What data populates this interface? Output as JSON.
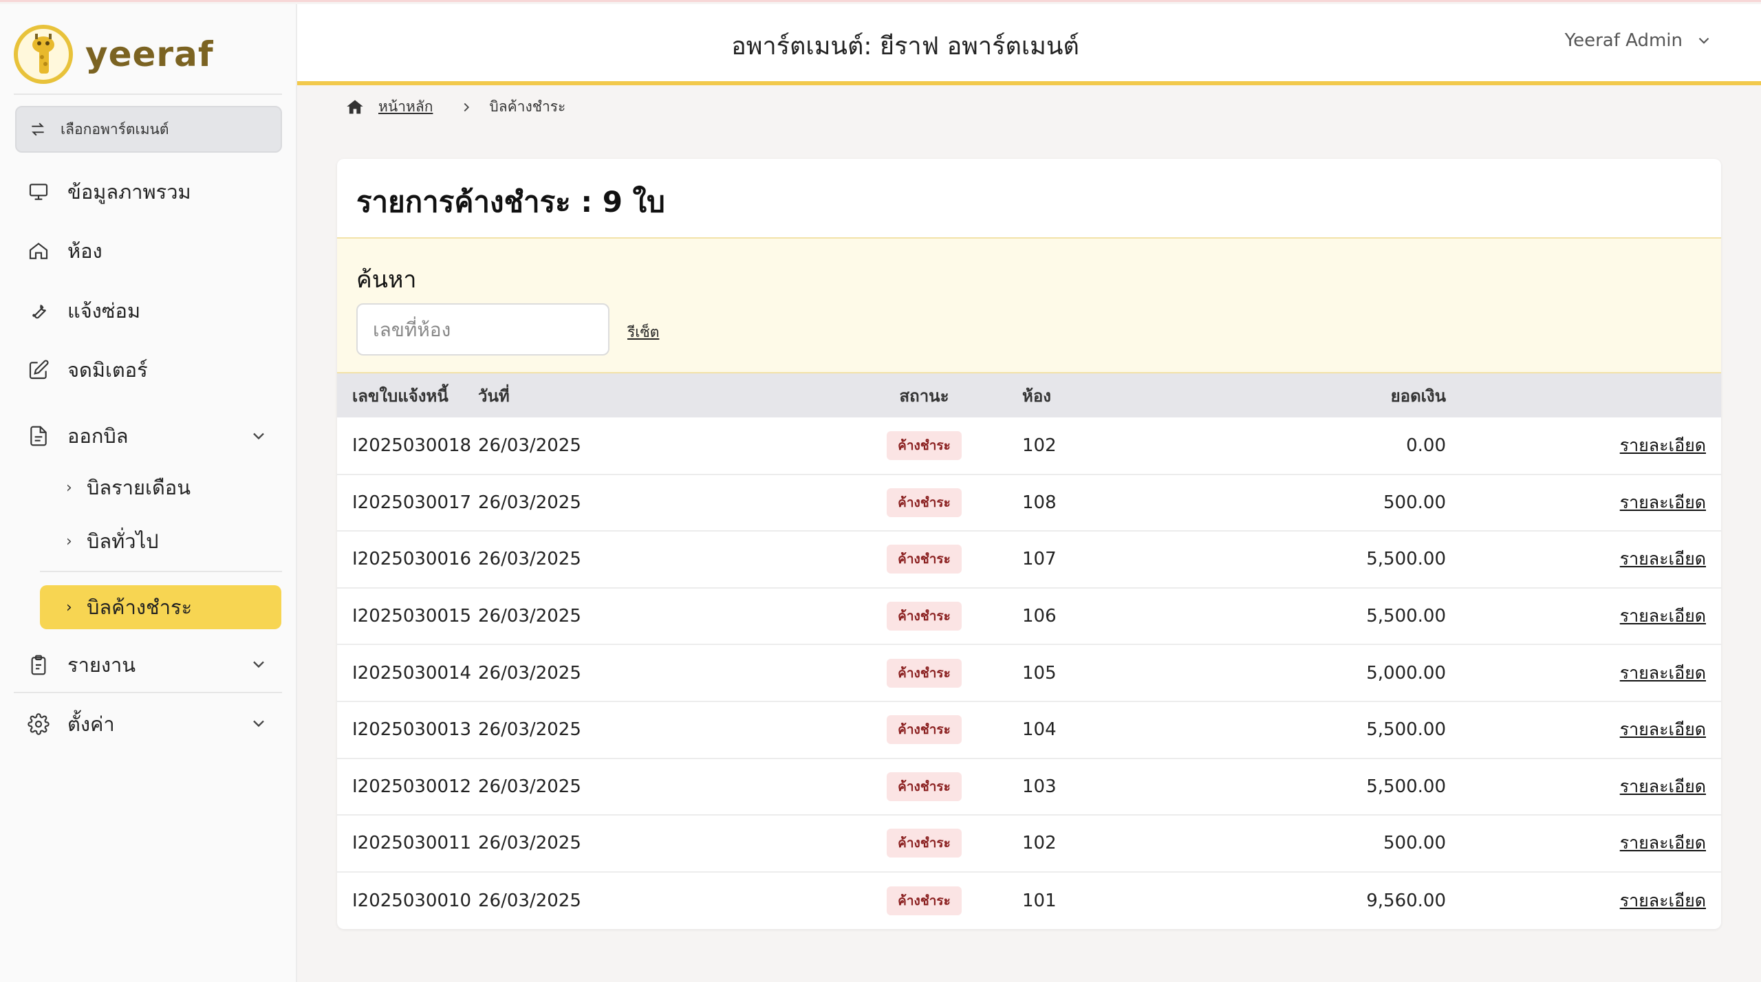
{
  "brand": {
    "name": "yeeraf",
    "accent": "#f2c94c",
    "active_bg": "#f7d552"
  },
  "sidebar": {
    "select_apartment": "เลือกอพาร์ตเมนต์",
    "items": [
      {
        "label": "ข้อมูลภาพรวม",
        "icon": "monitor-icon"
      },
      {
        "label": "ห้อง",
        "icon": "home-icon"
      },
      {
        "label": "แจ้งซ่อม",
        "icon": "wrench-icon"
      },
      {
        "label": "จดมิเตอร์",
        "icon": "edit-icon"
      },
      {
        "label": "ออกบิล",
        "icon": "document-icon"
      },
      {
        "label": "รายงาน",
        "icon": "clipboard-icon"
      },
      {
        "label": "ตั้งค่า",
        "icon": "gear-icon"
      }
    ],
    "billing_sub": [
      "บิลรายเดือน",
      "บิลทั่วไป",
      "บิลค้างชำระ"
    ]
  },
  "header": {
    "title": "อพาร์ตเมนต์: ยีราฟ อพาร์ตเมนต์",
    "user": "Yeeraf Admin"
  },
  "breadcrumb": {
    "home": "หน้าหลัก",
    "current": "บิลค้างชำระ"
  },
  "card": {
    "title": "รายการค้างชำระ : 9 ใบ",
    "search_label": "ค้นหา",
    "search_placeholder": "เลขที่ห้อง",
    "reset": "รีเซ็ต"
  },
  "table": {
    "headers": [
      "เลขใบแจ้งหนี้",
      "วันที่",
      "สถานะ",
      "ห้อง",
      "ยอดเงิน"
    ],
    "rows": [
      {
        "invoice": "I2025030018",
        "date": "26/03/2025",
        "status": "ค้างชำระ",
        "room": "102",
        "amount": "0.00",
        "action": "รายละเอียด"
      },
      {
        "invoice": "I2025030017",
        "date": "26/03/2025",
        "status": "ค้างชำระ",
        "room": "108",
        "amount": "500.00",
        "action": "รายละเอียด"
      },
      {
        "invoice": "I2025030016",
        "date": "26/03/2025",
        "status": "ค้างชำระ",
        "room": "107",
        "amount": "5,500.00",
        "action": "รายละเอียด"
      },
      {
        "invoice": "I2025030015",
        "date": "26/03/2025",
        "status": "ค้างชำระ",
        "room": "106",
        "amount": "5,500.00",
        "action": "รายละเอียด"
      },
      {
        "invoice": "I2025030014",
        "date": "26/03/2025",
        "status": "ค้างชำระ",
        "room": "105",
        "amount": "5,000.00",
        "action": "รายละเอียด"
      },
      {
        "invoice": "I2025030013",
        "date": "26/03/2025",
        "status": "ค้างชำระ",
        "room": "104",
        "amount": "5,500.00",
        "action": "รายละเอียด"
      },
      {
        "invoice": "I2025030012",
        "date": "26/03/2025",
        "status": "ค้างชำระ",
        "room": "103",
        "amount": "5,500.00",
        "action": "รายละเอียด"
      },
      {
        "invoice": "I2025030011",
        "date": "26/03/2025",
        "status": "ค้างชำระ",
        "room": "102",
        "amount": "500.00",
        "action": "รายละเอียด"
      },
      {
        "invoice": "I2025030010",
        "date": "26/03/2025",
        "status": "ค้างชำระ",
        "room": "101",
        "amount": "9,560.00",
        "action": "รายละเอียด"
      }
    ]
  }
}
